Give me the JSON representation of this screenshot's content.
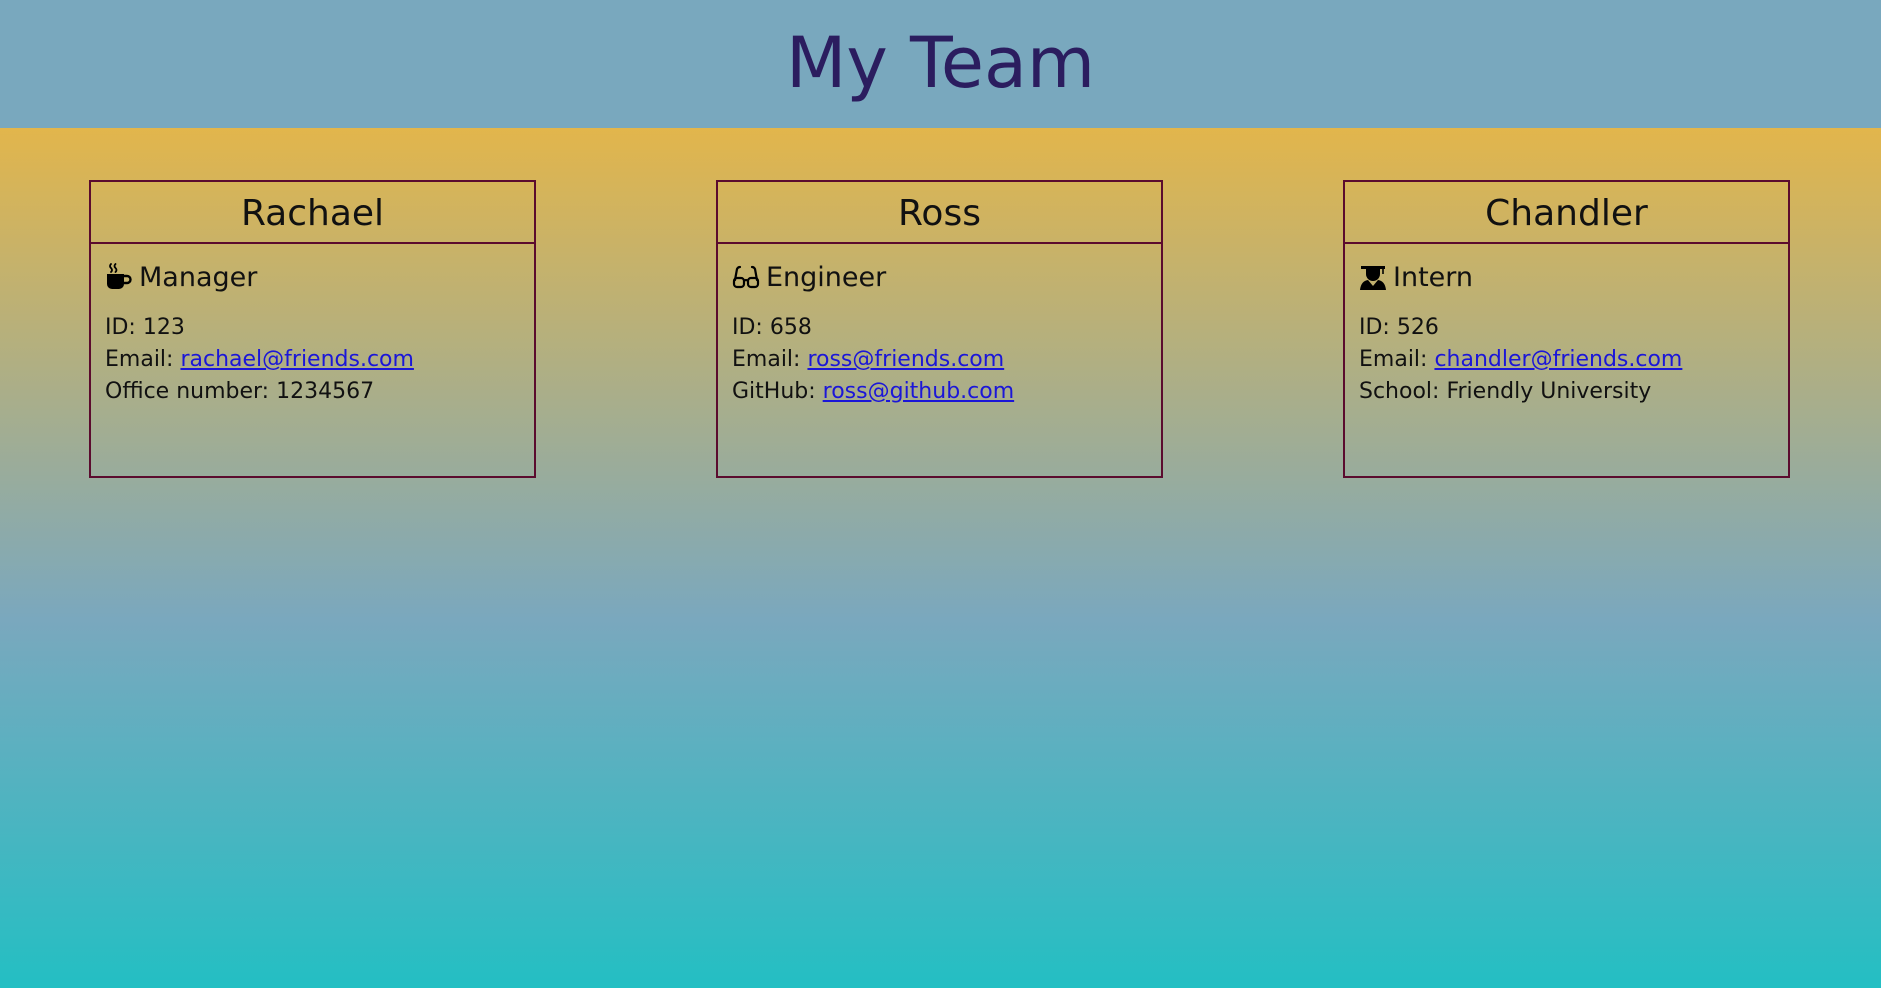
{
  "header": {
    "title": "My Team"
  },
  "team": [
    {
      "name": "Rachael",
      "role": "Manager",
      "role_icon": "coffee-mug-icon",
      "id_label": "ID: ",
      "id": "123",
      "email_label": "Email: ",
      "email": "rachael@friends.com",
      "extra_label": "Office number: ",
      "extra_value": "1234567"
    },
    {
      "name": "Ross",
      "role": "Engineer",
      "role_icon": "glasses-icon",
      "id_label": "ID: ",
      "id": "658",
      "email_label": "Email: ",
      "email": "ross@friends.com",
      "extra_label": "GitHub: ",
      "extra_value": "ross@github.com"
    },
    {
      "name": "Chandler",
      "role": "Intern",
      "role_icon": "graduate-icon",
      "id_label": "ID: ",
      "id": "526",
      "email_label": "Email: ",
      "email": "chandler@friends.com",
      "extra_label": "School: ",
      "extra_value": "Friendly University"
    }
  ],
  "colors": {
    "header_bg": "#79A8BE",
    "title": "#2B1D5F",
    "card_border": "#5B0B2E",
    "link": "#1B16D8",
    "gradient_top": "#FDB92E",
    "gradient_mid": "#7AA8BE",
    "gradient_bottom": "#23BFC3"
  }
}
